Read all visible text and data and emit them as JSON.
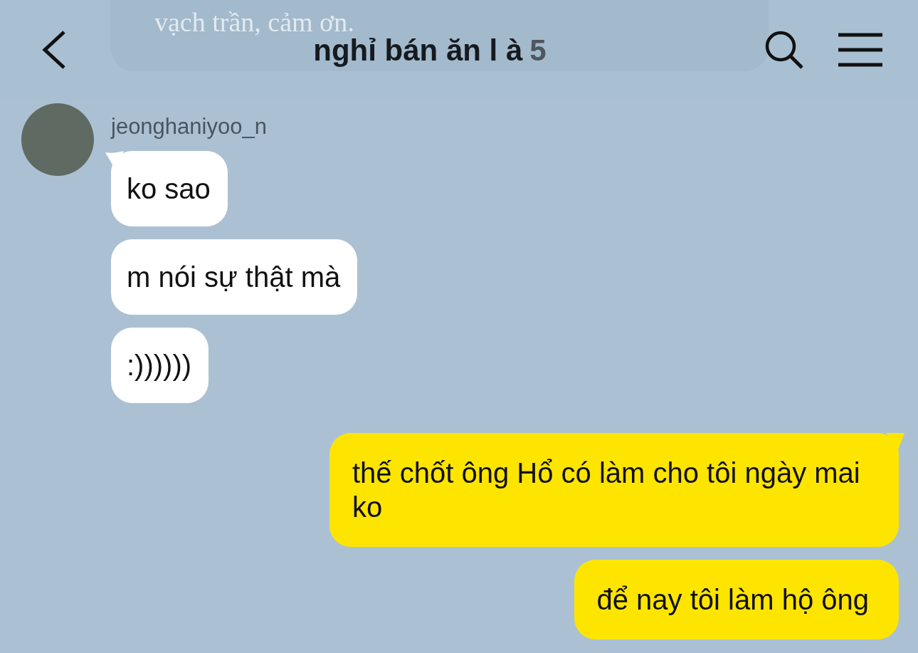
{
  "header": {
    "title": "nghỉ bán ăn l à",
    "member_count": "5",
    "background_message": "vạch trần, cảm ơn."
  },
  "groups": [
    {
      "kind": "received",
      "sender": "jeonghaniyoo_n",
      "messages": [
        "ko sao",
        "m nói sự thật mà",
        ":))))))"
      ]
    },
    {
      "kind": "sent",
      "messages": [
        "thế chốt ông Hổ có làm cho tôi ngày mai ko",
        "để nay tôi làm hộ ông"
      ]
    }
  ]
}
